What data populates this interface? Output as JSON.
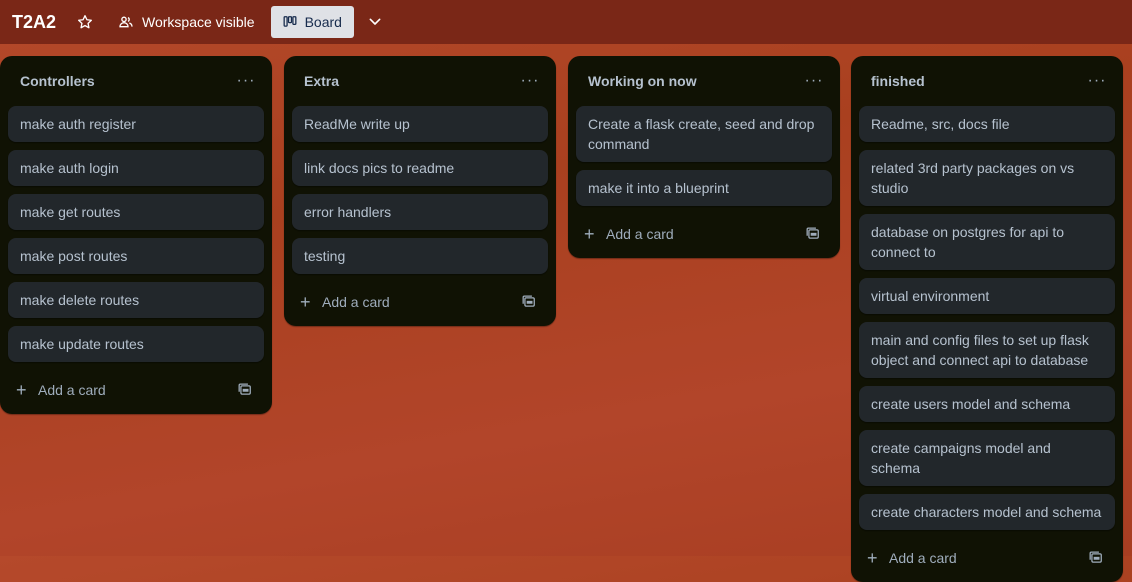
{
  "header": {
    "board_title": "T2A2",
    "visibility_label": "Workspace visible",
    "view_label": "Board"
  },
  "lists": [
    {
      "title": "Controllers",
      "menu": "···",
      "add_card": "Add a card",
      "cards": [
        "make auth register",
        "make auth login",
        "make get routes",
        "make post routes",
        "make delete routes",
        "make update routes"
      ]
    },
    {
      "title": "Extra",
      "menu": "···",
      "add_card": "Add a card",
      "cards": [
        "ReadMe write up",
        "link docs pics to readme",
        "error handlers",
        "testing"
      ]
    },
    {
      "title": "Working on now",
      "menu": "···",
      "add_card": "Add a card",
      "cards": [
        "Create a flask create, seed and drop command",
        "make it into a blueprint"
      ]
    },
    {
      "title": "finished",
      "menu": "···",
      "add_card": "Add a card",
      "cards": [
        "Readme, src, docs file",
        "related 3rd party packages on vs studio",
        "database on postgres for api to connect to",
        "virtual environment",
        "main and config files to set up flask object and connect api to database",
        "create users model and schema",
        "create campaigns model and schema",
        "create characters model and schema"
      ]
    }
  ],
  "icons": {
    "star": "star-icon",
    "visibility": "people-icon",
    "board": "board-icon",
    "chevron": "chevron-down-icon",
    "template": "card-template-icon"
  }
}
